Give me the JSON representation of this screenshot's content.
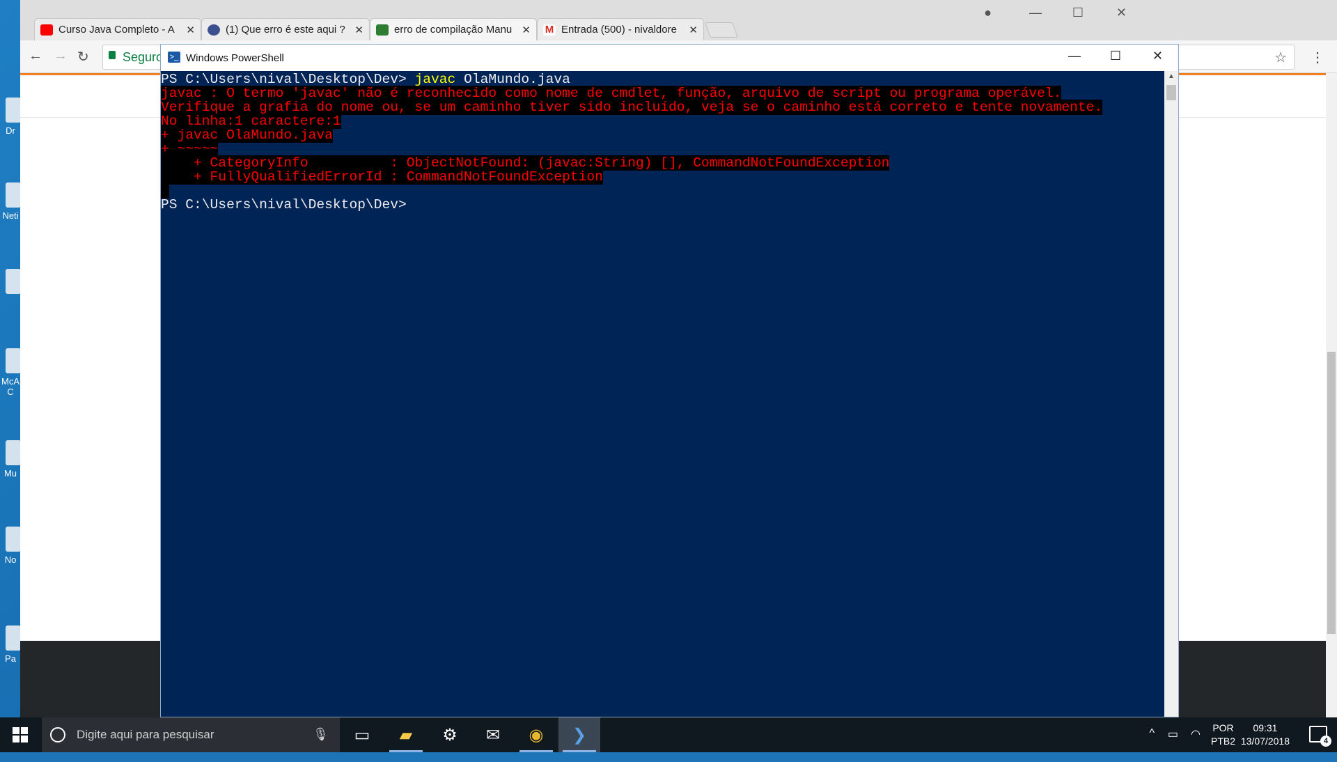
{
  "desktop": {
    "icons": [
      {
        "label": "Dr",
        "icon": "drive-icon"
      },
      {
        "label": "Neti",
        "icon": "netbeans-icon"
      },
      {
        "label": "",
        "icon": "app-icon"
      },
      {
        "label": "McA C",
        "icon": "mcafee-icon"
      },
      {
        "label": "Mu",
        "icon": "music-icon"
      },
      {
        "label": "No",
        "icon": "notepad-icon"
      },
      {
        "label": "Pa",
        "icon": "paint-icon"
      }
    ]
  },
  "browser": {
    "tabs": [
      {
        "title": "Curso Java Completo - A",
        "favicon": "youtube-icon",
        "color": "#ff0000"
      },
      {
        "title": "(1) Que erro é este aqui ?",
        "favicon": "stackoverflow-icon",
        "color": "#3c4f8f"
      },
      {
        "title": "erro de compilação Manu",
        "favicon": "stackoverflow-pt-icon",
        "color": "#2e7d32"
      },
      {
        "title": "Entrada (500) - nivaldore",
        "favicon": "gmail-icon",
        "color": "#d93025"
      }
    ],
    "omnibox_secure_label": "Seguro",
    "accent_color": "#f48024"
  },
  "powershell": {
    "title": "Windows PowerShell",
    "lines": [
      {
        "prompt": "PS C:\\Users\\nival\\Desktop\\Dev> ",
        "cmd": "javac",
        "rest": " OlaMundo.java"
      },
      {
        "err": "javac : O termo 'javac' não é reconhecido como nome de cmdlet, função, arquivo de script ou programa operável."
      },
      {
        "err": "Verifique a grafia do nome ou, se um caminho tiver sido incluído, veja se o caminho está correto e tente novamente."
      },
      {
        "err": "No linha:1 caractere:1"
      },
      {
        "err": "+ javac OlaMundo.java"
      },
      {
        "err": "+ ~~~~~"
      },
      {
        "err": "    + CategoryInfo          : ObjectNotFound: (javac:String) [], CommandNotFoundException"
      },
      {
        "err": "    + FullyQualifiedErrorId : CommandNotFoundException"
      },
      {
        "err": " "
      },
      {
        "prompt": "PS C:\\Users\\nival\\Desktop\\Dev> ",
        "cmd": "",
        "rest": ""
      }
    ],
    "bg_color": "#012456",
    "error_color": "#ff0000"
  },
  "taskbar": {
    "search_placeholder": "Digite aqui para pesquisar",
    "apps": [
      "task-view-icon",
      "file-explorer-icon",
      "settings-icon",
      "mail-icon",
      "chrome-icon",
      "powershell-icon"
    ],
    "language_top": "POR",
    "language_bottom": "PTB2",
    "time": "09:31",
    "date": "13/07/2018",
    "notifications": "4"
  }
}
